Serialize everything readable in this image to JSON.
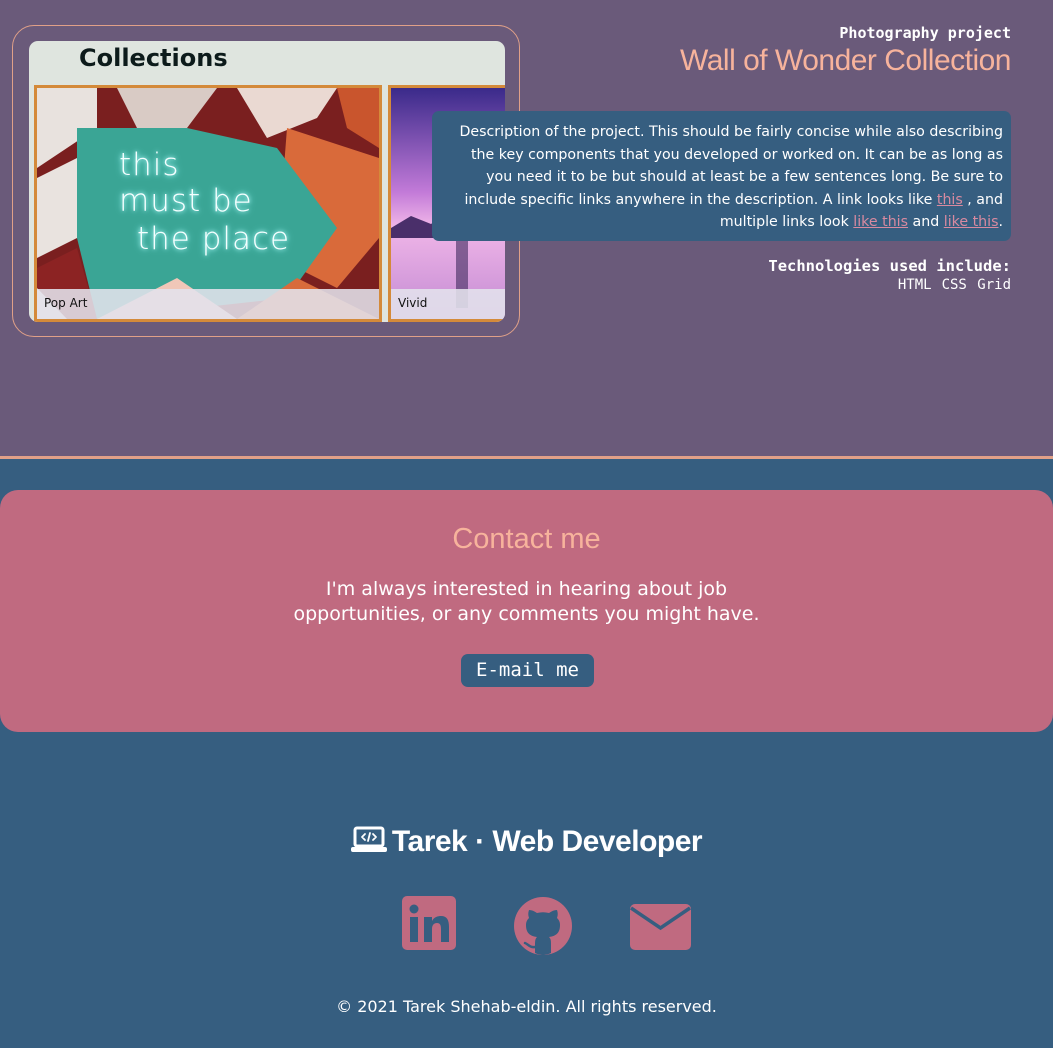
{
  "project": {
    "kicker": "Photography project",
    "title": "Wall of Wonder Collection",
    "description": {
      "text_before": "Description of the project. This should be fairly concise while also describing the key components that you developed or worked on. It can be as long as you need it to be but should at least be a few sentences long. Be sure to include specific links anywhere in the description. A link looks like ",
      "link1": "this",
      "text_middle": " , and multiple links look ",
      "link2": "like this",
      "text_and": " and ",
      "link3": "like this",
      "text_end": "."
    },
    "tech_heading": "Technologies used include:",
    "tech": [
      "HTML",
      "CSS Grid"
    ]
  },
  "preview": {
    "title": "Collections",
    "items": [
      {
        "caption": "Pop Art",
        "neon_lines": [
          "this",
          "must be",
          "the place"
        ]
      },
      {
        "caption": "Vivid"
      }
    ]
  },
  "contact": {
    "title": "Contact me",
    "line1": "I'm always interested in hearing about job",
    "line2": "opportunities, or any comments you might have.",
    "button": "E-mail me"
  },
  "footer": {
    "brand": "Tarek · Web Developer",
    "social_icons": [
      "linkedin-icon",
      "github-icon",
      "envelope-icon"
    ],
    "copyright": "© 2021 Tarek Shehab-eldin. All rights reserved."
  },
  "colors": {
    "project_bg": "#6a5a7a",
    "page_bg": "#365e80",
    "accent_peach": "#f7b39c",
    "accent_pink": "#c06a80"
  }
}
